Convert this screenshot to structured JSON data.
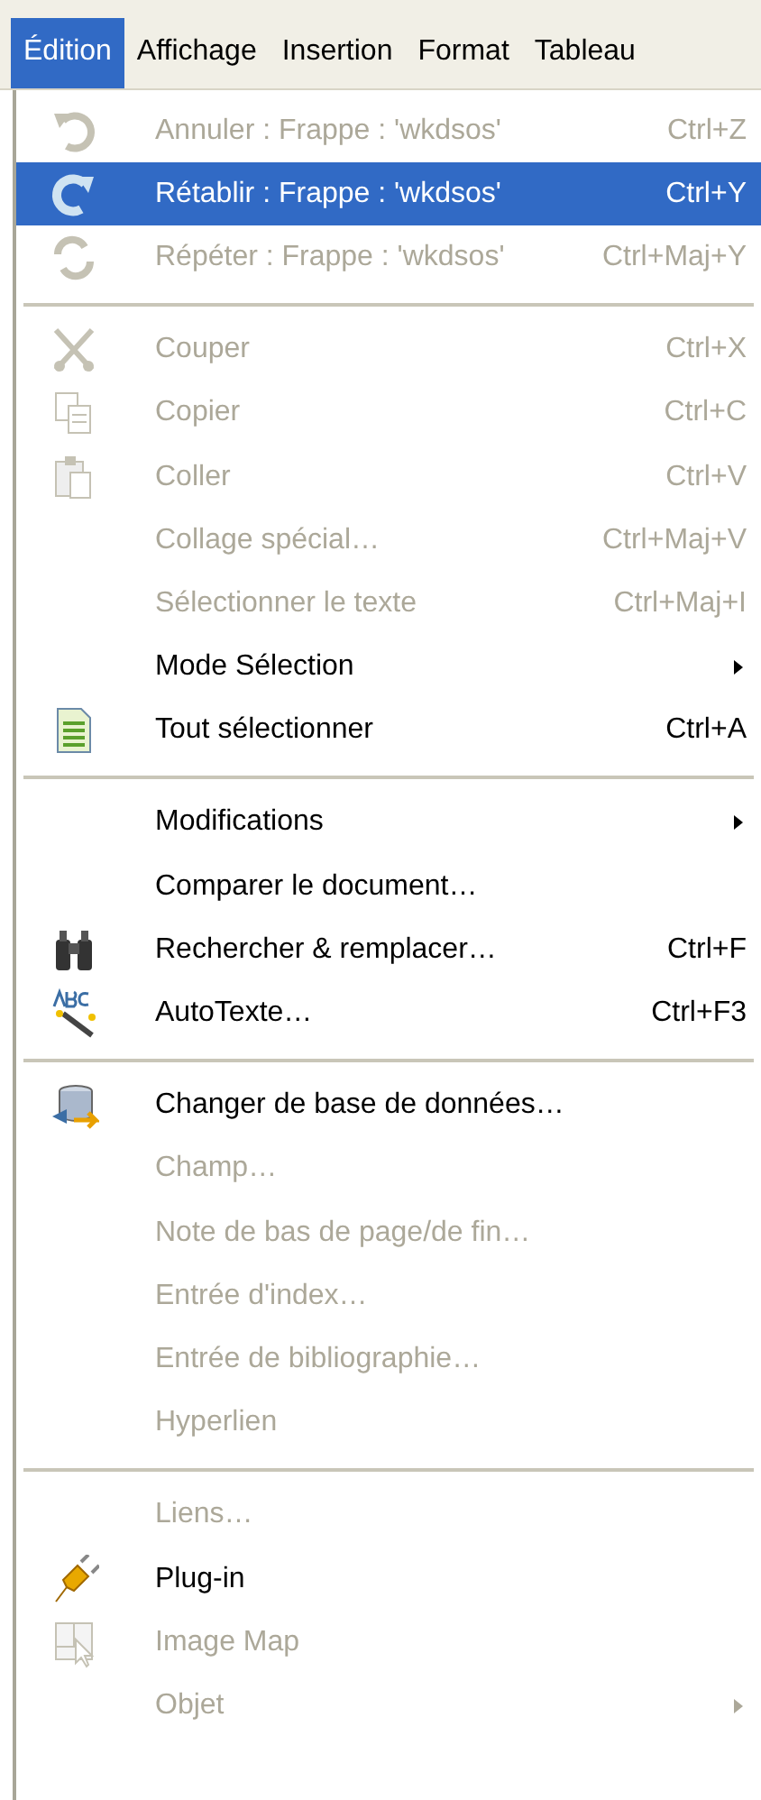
{
  "menubar": [
    {
      "label": "Édition",
      "selected": true
    },
    {
      "label": "Affichage",
      "selected": false
    },
    {
      "label": "Insertion",
      "selected": false
    },
    {
      "label": "Format",
      "selected": false
    },
    {
      "label": "Tableau",
      "selected": false
    }
  ],
  "menu": {
    "sections": [
      [
        {
          "label": "Annuler : Frappe : 'wkdsos'",
          "shortcut": "Ctrl+Z",
          "disabled": true,
          "selected": false,
          "kind": "undo"
        },
        {
          "label": "Rétablir : Frappe : 'wkdsos'",
          "shortcut": "Ctrl+Y",
          "disabled": false,
          "selected": true,
          "kind": "redo"
        },
        {
          "label": "Répéter : Frappe : 'wkdsos'",
          "shortcut": "Ctrl+Maj+Y",
          "disabled": true,
          "selected": false,
          "kind": "repeat"
        }
      ],
      [
        {
          "label": "Couper",
          "shortcut": "Ctrl+X",
          "disabled": true,
          "selected": false,
          "kind": "scissors"
        },
        {
          "label": "Copier",
          "shortcut": "Ctrl+C",
          "disabled": true,
          "selected": false,
          "kind": "copy"
        },
        {
          "label": "Coller",
          "shortcut": "Ctrl+V",
          "disabled": true,
          "selected": false,
          "kind": "clipboard"
        },
        {
          "label": "Collage spécial…",
          "shortcut": "Ctrl+Maj+V",
          "disabled": true,
          "selected": false
        },
        {
          "label": "Sélectionner le texte",
          "shortcut": "Ctrl+Maj+I",
          "disabled": true,
          "selected": false
        },
        {
          "label": "Mode Sélection",
          "disabled": false,
          "selected": false,
          "submenu": true
        },
        {
          "label": "Tout sélectionner",
          "shortcut": "Ctrl+A",
          "disabled": false,
          "selected": false,
          "kind": "document"
        }
      ],
      [
        {
          "label": "Modifications",
          "disabled": false,
          "selected": false,
          "submenu": true
        },
        {
          "label": "Comparer le document…",
          "disabled": false,
          "selected": false
        },
        {
          "label": "Rechercher & remplacer…",
          "shortcut": "Ctrl+F",
          "disabled": false,
          "selected": false,
          "kind": "binoculars"
        },
        {
          "label": "AutoTexte…",
          "shortcut": "Ctrl+F3",
          "disabled": false,
          "selected": false,
          "kind": "abc"
        }
      ],
      [
        {
          "label": "Changer de base de données…",
          "disabled": false,
          "selected": false,
          "kind": "database"
        },
        {
          "label": "Champ…",
          "disabled": true,
          "selected": false
        },
        {
          "label": "Note de bas de page/de fin…",
          "disabled": true,
          "selected": false
        },
        {
          "label": "Entrée d'index…",
          "disabled": true,
          "selected": false
        },
        {
          "label": "Entrée de bibliographie…",
          "disabled": true,
          "selected": false
        },
        {
          "label": "Hyperlien",
          "disabled": true,
          "selected": false
        }
      ],
      [
        {
          "label": "Liens…",
          "disabled": true,
          "selected": false
        },
        {
          "label": "Plug-in",
          "disabled": false,
          "selected": false,
          "kind": "plug"
        },
        {
          "label": "Image Map",
          "disabled": true,
          "selected": false,
          "kind": "imagemap"
        },
        {
          "label": "Objet",
          "disabled": true,
          "selected": false,
          "submenu": true
        }
      ]
    ]
  }
}
